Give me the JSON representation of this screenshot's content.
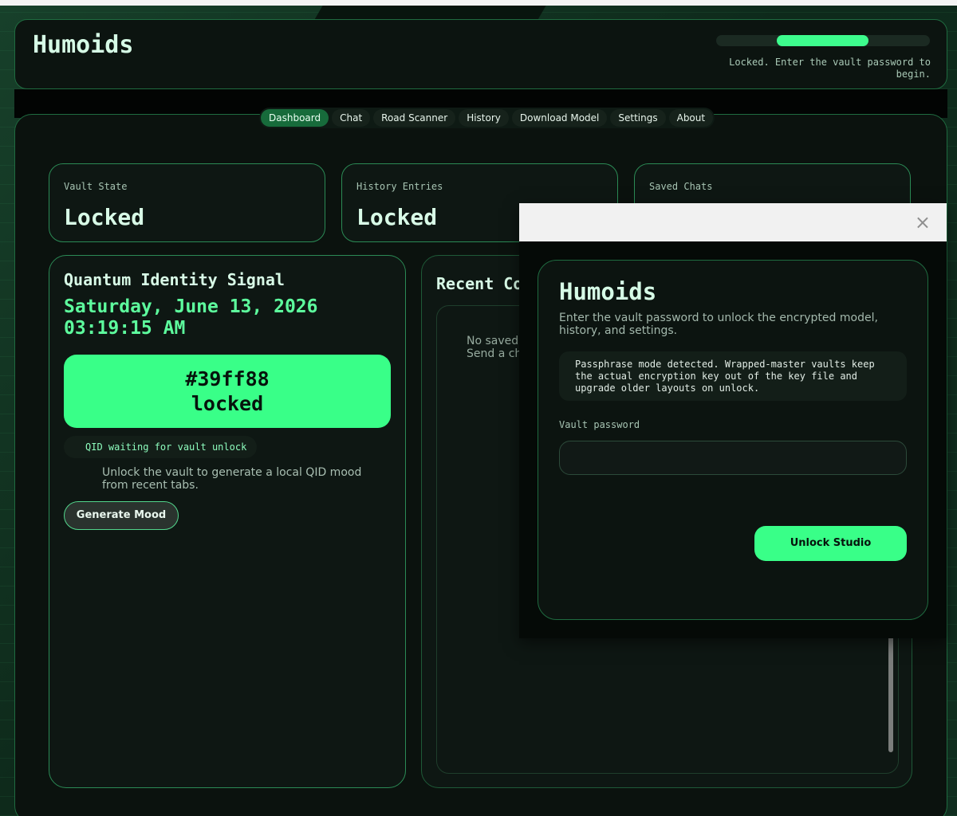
{
  "app": {
    "title": "Humoids",
    "status": "Locked. Enter the vault password to begin.",
    "progress_fraction": 0.43
  },
  "tabs": [
    {
      "label": "Dashboard",
      "active": true
    },
    {
      "label": "Chat"
    },
    {
      "label": "Road Scanner"
    },
    {
      "label": "History"
    },
    {
      "label": "Download Model"
    },
    {
      "label": "Settings"
    },
    {
      "label": "About"
    }
  ],
  "stats": [
    {
      "label": "Vault State",
      "value": "Locked"
    },
    {
      "label": "History Entries",
      "value": "Locked"
    },
    {
      "label": "Saved Chats",
      "value": ""
    }
  ],
  "qid": {
    "title": "Quantum Identity Signal",
    "date": "Saturday, June 13, 2026",
    "time": "03:19:15 AM",
    "color_hex": "#39ff88",
    "color_label": "#39ff88",
    "state": "locked",
    "badge": "QID waiting for vault unlock",
    "description": "Unlock the vault to generate a local QID mood from recent tabs.",
    "button": "Generate Mood"
  },
  "recent": {
    "title": "Recent Co",
    "empty_line1": "No saved",
    "empty_line2": "Send a ch"
  },
  "modal": {
    "title": "Humoids",
    "subtitle": "Enter the vault password to unlock the encrypted model, history, and settings.",
    "info": "Passphrase mode detected. Wrapped-master vaults keep the actual encryption key out of the key file and upgrade older layouts on unlock.",
    "password_label": "Vault password",
    "password_value": "",
    "unlock_button": "Unlock Studio",
    "close_glyph": "×"
  },
  "colors": {
    "accent": "#39ff88",
    "border": "#2b8a55",
    "panel": "#0e1713"
  }
}
